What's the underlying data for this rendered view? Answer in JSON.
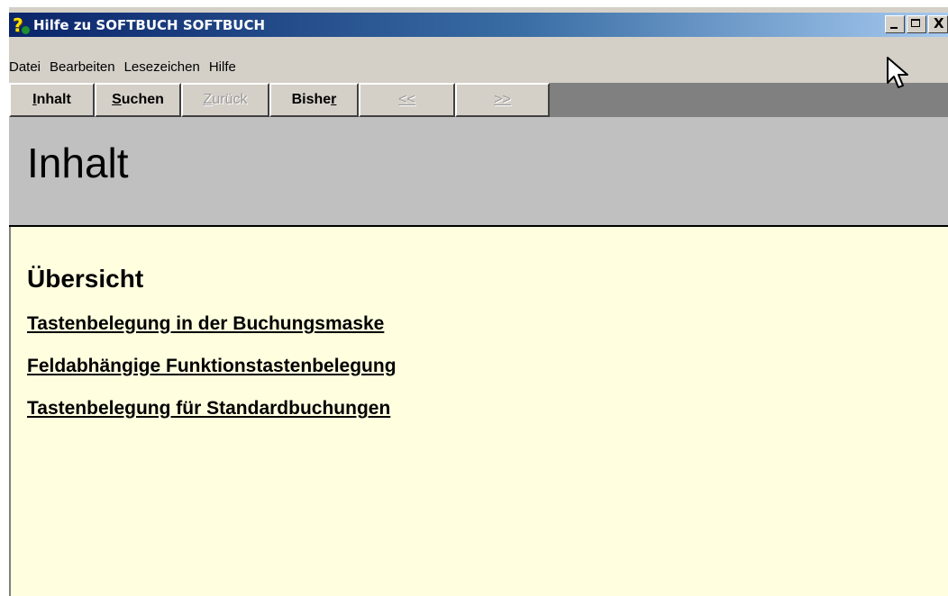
{
  "window": {
    "title": "Hilfe zu SOFTBUCH SOFTBUCH",
    "controls": {
      "minimize": "minimize-icon",
      "maximize": "maximize-icon",
      "close": "close-icon",
      "close_glyph": "X"
    },
    "icon": "help-question-icon"
  },
  "menu": {
    "items": [
      "Datei",
      "Bearbeiten",
      "Lesezeichen",
      "Hilfe"
    ]
  },
  "buttons": [
    {
      "label_pre": "",
      "label_ul": "I",
      "label_post": "nhalt",
      "enabled": true
    },
    {
      "label_pre": "",
      "label_ul": "S",
      "label_post": "uchen",
      "enabled": true
    },
    {
      "label_pre": "",
      "label_ul": "Z",
      "label_post": "urück",
      "enabled": false
    },
    {
      "label_pre": "Bishe",
      "label_ul": "r",
      "label_post": "",
      "enabled": true
    },
    {
      "label_pre": "",
      "label_ul": "<<",
      "label_post": "",
      "enabled": false
    },
    {
      "label_pre": "",
      "label_ul": ">>",
      "label_post": "",
      "enabled": false
    }
  ],
  "header": {
    "title": "Inhalt"
  },
  "content": {
    "section_title": "Übersicht",
    "links": [
      "Tastenbelegung in der Buchungsmaske",
      "Feldabhängige Funktionstastenbelegung",
      "Tastenbelegung für Standardbuchungen"
    ]
  },
  "colors": {
    "titlebar_start": "#0a246a",
    "titlebar_end": "#a6caf0",
    "content_bg": "#ffffe0",
    "header_bg": "#c0c0c0"
  }
}
